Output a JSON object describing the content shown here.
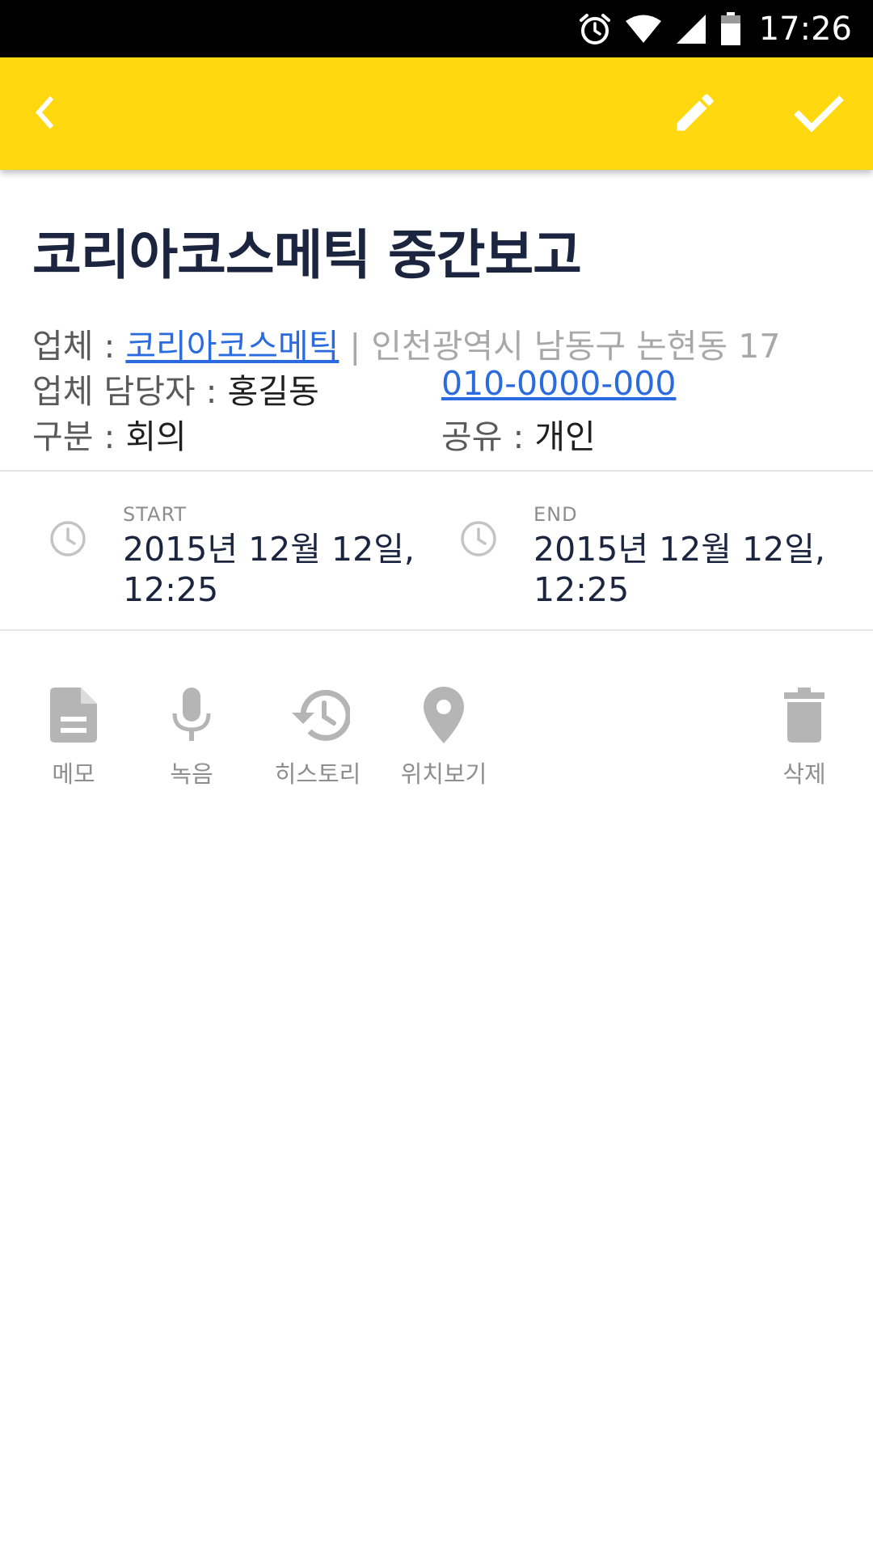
{
  "status_bar": {
    "time": "17:26",
    "icons": [
      "alarm-icon",
      "wifi-icon",
      "cell-signal-icon",
      "battery-icon"
    ]
  },
  "app_bar": {
    "background": "#ffd80f",
    "back_icon": "chevron-left-icon",
    "edit_icon": "pencil-icon",
    "confirm_icon": "check-icon"
  },
  "header": {
    "title": "코리아코스메틱 중간보고",
    "company_label": "업체 : ",
    "company_name": "코리아코스메틱",
    "separator": " | ",
    "address": "인천광역시 남동구 논현동 17",
    "contact_label": "업체 담당자 : ",
    "contact_name": "홍길동",
    "phone": "010-0000-000",
    "category_label": "구분 : ",
    "category_value": "회의",
    "share_label": "공유 : ",
    "share_value": "개인"
  },
  "schedule": {
    "start": {
      "label": "START",
      "date": "2015년 12월 12일,",
      "time": "12:25"
    },
    "end": {
      "label": "END",
      "date": "2015년 12월 12일,",
      "time": "12:25"
    }
  },
  "actions": {
    "memo": {
      "label": "메모",
      "icon": "document-icon"
    },
    "record": {
      "label": "녹음",
      "icon": "microphone-icon"
    },
    "history": {
      "label": "히스토리",
      "icon": "history-icon"
    },
    "location": {
      "label": "위치보기",
      "icon": "map-pin-icon"
    },
    "delete": {
      "label": "삭제",
      "icon": "trash-icon"
    }
  },
  "colors": {
    "accent": "#ffd80f",
    "link": "#2a6be0",
    "title": "#1b2540",
    "icon_gray": "#b5b5b5"
  }
}
